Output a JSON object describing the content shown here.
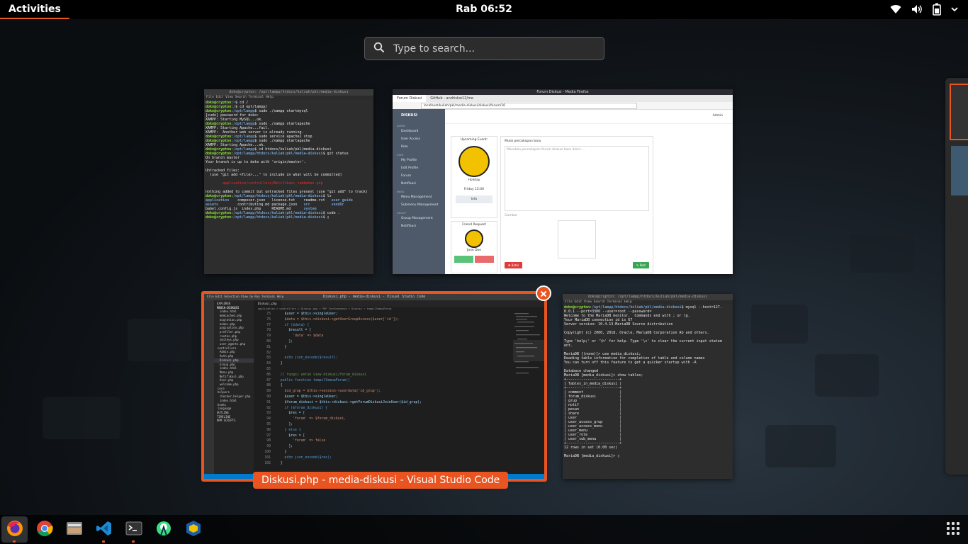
{
  "topbar": {
    "activities": "Activities",
    "clock": "Rab 06:52",
    "tray": {
      "wifi": "wifi-icon",
      "volume": "volume-icon",
      "battery": "battery-icon",
      "menu": "chevron-down-icon"
    }
  },
  "search": {
    "placeholder": "Type to search..."
  },
  "windows": {
    "terminal1": {
      "title": "doko@crypton: /opt/lampp/htdocs/kuliah/pkl/media-diskusi",
      "menu": "File  Edit  View  Search  Terminal  Help"
    },
    "firefox": {
      "title": "Forum Diskusi - Media Firefox",
      "tab1": "Forum Diskusi",
      "tab2": "GitHub - andriskw12/me",
      "url": "localhost/kuliah/pkl/media-diskusi/diskusi/forum/16",
      "brand": "DISKUSI",
      "sidebar": [
        "Dashboard",
        "User Access",
        "Role",
        "My Profile",
        "Edit Profile",
        "Forum",
        "Notifikasi",
        "Menu Management",
        "Submenu Management",
        "Group Management",
        "Notifikasi"
      ],
      "sections": [
        "ADMIN",
        "USER",
        "MENU",
        "GROUP"
      ],
      "upcoming_title": "Upcoming Event:",
      "event_name": "Holiday",
      "event_date": "Friday 15:00",
      "info_button": "Info",
      "friend_title": "Friend Request",
      "friend_name": "Jane Doe",
      "post_title": "Mulai percakapan baru",
      "post_placeholder": "Masukan percakapan forum diskusi baru disini....",
      "image_label": "Gambar",
      "cancel_button": "✖ Batal",
      "post_button": "✎ Post",
      "user": "Admin"
    },
    "vscode": {
      "title": "Diskusi.php - media-diskusi - Visual Studio Code",
      "menu": "File  Edit  Selection  View  Go  Run  Terminal  Help",
      "tab": "Diskusi.php",
      "breadcrumbs": "application > controllers > Diskusi.php > PHP Intelephense > Diskusi > tampilSemuaForum",
      "explorer_header": "EXPLORER",
      "explorer_root": "MEDIA-DISKUSI",
      "files": [
        "index.html",
        "memcached.php",
        "migration.php",
        "mimes.php",
        "pagination.php",
        "profiler.php",
        "routes.php",
        "smileys.php",
        "user_agents.php",
        "controllers",
        "Admin.php",
        "Auth.php",
        "Diskusi.php",
        "Group.php",
        "index.html",
        "Menu.php",
        "Notifikasi.php",
        "User.php",
        "welcome.php",
        "core",
        "helpers",
        "checker_helper.php",
        "index.html",
        "hooks",
        "language"
      ],
      "outline": "OUTLINE",
      "timeline": "TIMELINE",
      "npm": "NPM SCRIPTS",
      "code": [
        {
          "n": "75",
          "t": "    $user = $this->singleUser;"
        },
        {
          "n": "76",
          "t": "    $data = $this->diskusi->getUserGroupAccess($user['id']);"
        },
        {
          "n": "77",
          "t": "    if ($data) {"
        },
        {
          "n": "78",
          "t": "      $result = ["
        },
        {
          "n": "79",
          "t": "        'data' => $data"
        },
        {
          "n": "80",
          "t": "      ];"
        },
        {
          "n": "81",
          "t": "    }"
        },
        {
          "n": "82",
          "t": ""
        },
        {
          "n": "83",
          "t": "    echo json_encode($result);"
        },
        {
          "n": "84",
          "t": "  }"
        },
        {
          "n": "85",
          "t": ""
        },
        {
          "n": "86",
          "t": "  // fungsi untuk view diskusi/forum_diskusi"
        },
        {
          "n": "87",
          "t": "  public function tampilSemuaForum()"
        },
        {
          "n": "88",
          "t": "  {"
        },
        {
          "n": "89",
          "t": "    $id_grup = $this->session->userdata('id_grup');"
        },
        {
          "n": "90",
          "t": "    $user = $this->singleUser;"
        },
        {
          "n": "91",
          "t": "    $forum_diskusi = $this->diskusi->getForumDiskusiJoinUser($id_grup);"
        },
        {
          "n": "92",
          "t": "    if ($forum_diskusi) {"
        },
        {
          "n": "93",
          "t": "      $res = ["
        },
        {
          "n": "94",
          "t": "        'forum' => $forum_diskusi,"
        },
        {
          "n": "95",
          "t": "      ];"
        },
        {
          "n": "96",
          "t": "    } else {"
        },
        {
          "n": "97",
          "t": "      $res = ["
        },
        {
          "n": "98",
          "t": "        'forum' => false"
        },
        {
          "n": "99",
          "t": "      ];"
        },
        {
          "n": "100",
          "t": "    }"
        },
        {
          "n": "101",
          "t": "    echo json_encode($res);"
        },
        {
          "n": "102",
          "t": "  }"
        }
      ],
      "caption": "Diskusi.php - media-diskusi - Visual Studio Code"
    },
    "terminal2": {
      "title": "doko@crypton: /opt/lampp/htdocs/kuliah/pkl/media-diskusi",
      "menu": "File  Edit  View  Search  Terminal  Help"
    }
  },
  "dock": [
    "firefox-icon",
    "chrome-icon",
    "files-icon",
    "vscode-icon",
    "terminal-icon",
    "android-studio-icon",
    "virtualbox-icon",
    "show-apps-icon"
  ],
  "colors": {
    "accent": "#e95420",
    "topbar": "#000000",
    "vscode_status": "#007acc"
  }
}
